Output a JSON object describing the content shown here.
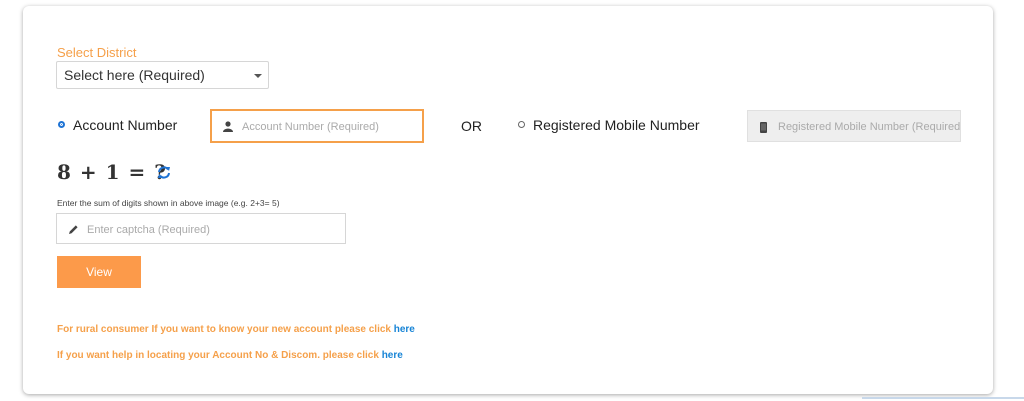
{
  "district": {
    "label": "Select District",
    "select_value": "Select here (Required)"
  },
  "options": {
    "account_label": "Account Number",
    "or_text": "OR",
    "mobile_label": "Registered Mobile Number"
  },
  "inputs": {
    "account_placeholder": "Account Number (Required)",
    "mobile_placeholder": "Registered Mobile Number (Required)",
    "captcha_placeholder": "Enter captcha (Required)"
  },
  "captcha": {
    "expression": "8 + 1 = ?",
    "hint": "Enter the sum of digits shown in above image (e.g. 2+3= 5)"
  },
  "buttons": {
    "view_label": "View"
  },
  "links": {
    "rural_text": "For rural consumer If you want to know your new account please click ",
    "rural_link": "here",
    "help_text": "If you want help in locating your Account No & Discom. please click ",
    "help_link": "here"
  },
  "colors": {
    "accent_orange": "#fc9a4a",
    "link_blue": "#1784d6",
    "radio_blue": "#1e73d4"
  },
  "icons": {
    "account": "user-icon",
    "mobile": "phone-icon",
    "captcha": "pencil-icon",
    "refresh": "refresh-icon"
  }
}
